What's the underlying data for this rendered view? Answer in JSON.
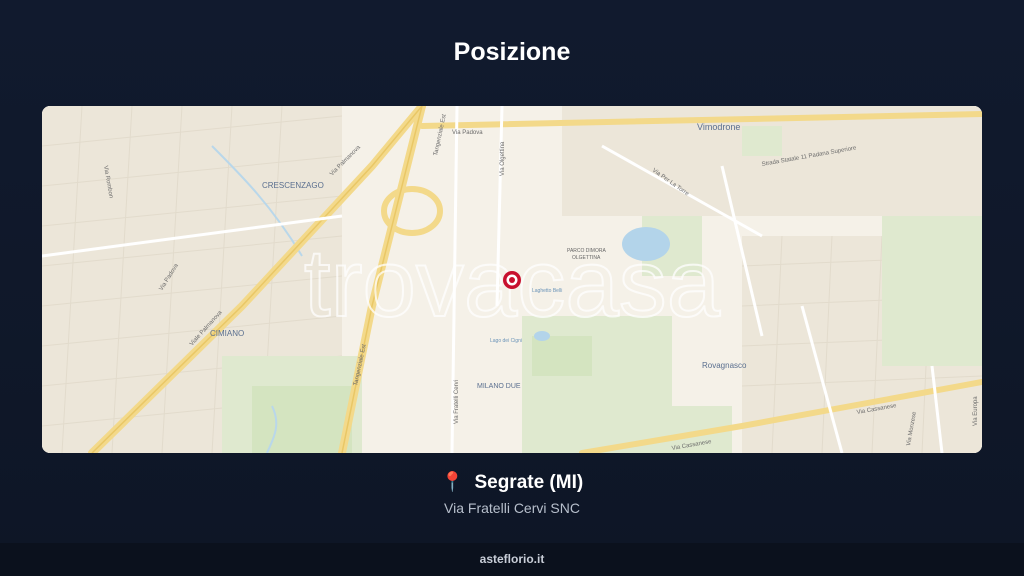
{
  "page": {
    "title": "Posizione"
  },
  "map": {
    "watermark": "trovacasa",
    "labels": {
      "crescenzago": "CRESCENZAGO",
      "cimiano": "CIMIANO",
      "vimodrone": "Vimodrone",
      "rovagnasco": "Rovagnasco",
      "milano_due": "MILANO DUE",
      "parco": "PARCO DIMORA",
      "parco2": "OLGETTINA",
      "laghetto": "Laghetto Belli",
      "lago_cigni": "Lago dei Cigni",
      "via_padova_top": "Via Padova",
      "via_palmanova": "Via Palmanova",
      "viale_palmanova": "Viale Palmanova",
      "tangenziale_est": "Tangenziale Est",
      "tangenziale_est2": "Tangenziale Est",
      "strada_statale": "Strada Statale 11 Padana Superiore",
      "via_cassanese": "Via Cassanese",
      "via_cassanese2": "Via Cassanese",
      "via_padova_left": "Via Padova",
      "via_fratelli_cervi": "Via Fratelli Cervi",
      "via_olgettina": "Via Olgettina",
      "via_la_torre": "Via Per La Torre",
      "via_monzese": "Via Monzese",
      "via_europa": "Via Europa",
      "via_rombon": "Via Rombon"
    },
    "marker_color": "#c8102e"
  },
  "location": {
    "pin_icon": "📍",
    "city": "Segrate (MI)",
    "address": "Via Fratelli Cervi SNC"
  },
  "footer": {
    "site": "asteflorio.it"
  }
}
